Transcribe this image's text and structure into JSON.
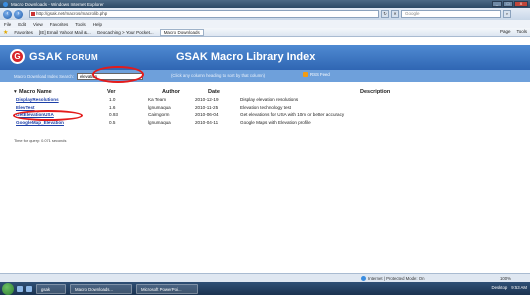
{
  "window": {
    "title": "Macro Downloads - Windows Internet Explorer",
    "buttons": [
      "_",
      "□",
      "X"
    ]
  },
  "address": {
    "url": "http://gsak.net/macros/macrolib.php",
    "search_placeholder": "Google"
  },
  "menu": [
    "File",
    "Edit",
    "View",
    "Favorites",
    "Tools",
    "Help"
  ],
  "favorites": {
    "label": "Favorites",
    "items": [
      "[IE] Email Yahoo! Mail &...",
      "Geocaching > Your Pocket...",
      "Macro Downloads"
    ],
    "right": [
      "Page",
      "Tools"
    ]
  },
  "page": {
    "logo_letter": "G",
    "logo_text_main": "GSAK",
    "logo_text_small": "FORUM",
    "title": "GSAK Macro Library Index",
    "search_label": "Macro Download Index Search:",
    "search_value": "elevation",
    "hint": "(Click any column heading to sort by that column)",
    "rss": "RSS Feed",
    "columns": [
      "Macro Name",
      "Ver",
      "Author",
      "Date",
      "Description"
    ],
    "rows": [
      {
        "name": "DisplayResolutions",
        "ver": "1.0",
        "author": "Ka Team",
        "date": "2010-12-19",
        "desc": "Display elevation resolutions"
      },
      {
        "name": "ElevTest",
        "ver": "1.6",
        "author": "lgnumaqua",
        "date": "2010-11-25",
        "desc": "Elevation technology test"
      },
      {
        "name": "GetElevationUSA",
        "ver": "0.93",
        "author": "Cairngorm",
        "date": "2010-06-04",
        "desc": "Get elevations for USA with 10m or better accuracy"
      },
      {
        "name": "GoogleMap_Elevation",
        "ver": "0.5",
        "author": "lgnumaqua",
        "date": "2010-04-11",
        "desc": "Google Maps with Elevation profile"
      }
    ],
    "timing": "Time for query: 0.071 seconds"
  },
  "status": {
    "zone": "Internet | Protected Mode: On",
    "zoom": "100%"
  },
  "taskbar": {
    "start": "start",
    "tasks": [
      "gsak",
      "Macro Downloads...",
      "Microsoft PowerPoi..."
    ],
    "tray": [
      "Desktop",
      "9:53 AM"
    ]
  }
}
